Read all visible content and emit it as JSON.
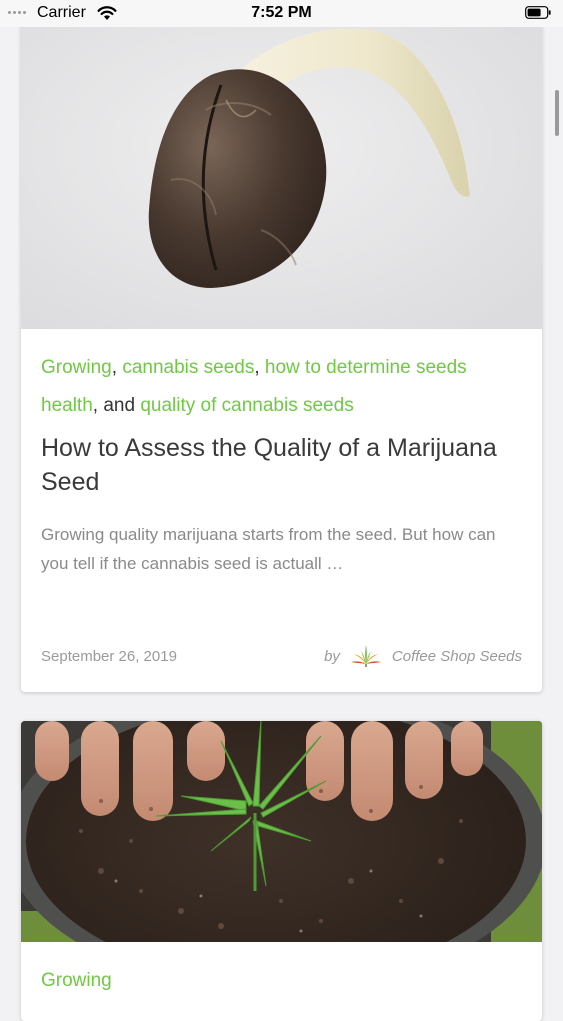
{
  "status_bar": {
    "carrier": "Carrier",
    "time": "7:52 PM"
  },
  "articles": [
    {
      "tags": [
        "Growing",
        "cannabis seeds",
        "how to determine seeds health",
        "quality of cannabis seeds"
      ],
      "separators": [
        ", ",
        ", ",
        ", and "
      ],
      "title": "How to Assess the Quality of a Marijuana Seed",
      "excerpt": "Growing quality marijuana starts from the seed. But how can you tell if the cannabis seed is actuall …",
      "date": "September 26, 2019",
      "by_label": "by",
      "author": "Coffee Shop Seeds"
    },
    {
      "tags": [
        "Growing"
      ]
    }
  ],
  "colors": {
    "tag_green": "#6fc944",
    "title_text": "#3a3a3a",
    "muted_text": "#8a8a8a",
    "background": "#f2f2f4"
  },
  "icons": {
    "wifi": "wifi-icon",
    "battery": "battery-icon",
    "author_logo": "cannabis-leaf-icon"
  }
}
